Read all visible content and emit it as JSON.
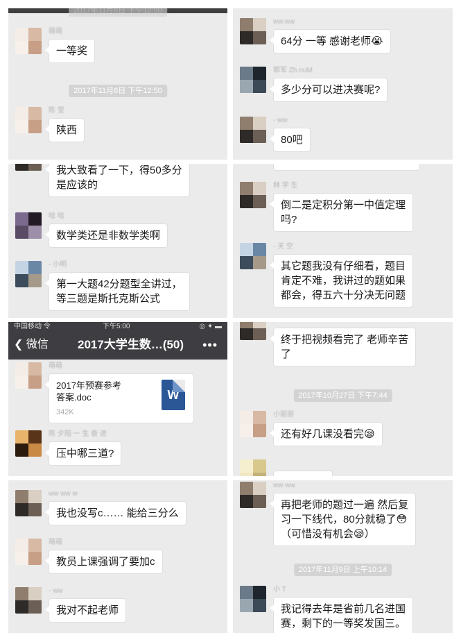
{
  "panel1": {
    "top_timestamp": "2017年11月8日 下午12:50",
    "msg1": {
      "name": "萌萌",
      "text": "一等奖"
    },
    "timestamp": "2017年11月8日 下午12:50",
    "msg2": {
      "name": "陈 莹",
      "text": "陕西"
    }
  },
  "panel2": {
    "msg1": {
      "name": "ww.ww",
      "text": "64分 一等 感谢老师😭"
    },
    "msg2": {
      "name": "郭军 Zh.nuM",
      "text": "多少分可以进决赛呢?"
    },
    "msg3": {
      "name": "- ww",
      "text": "80吧"
    }
  },
  "panel3": {
    "msg1": {
      "text": "我大致看了一下，得50多分\n是应该的"
    },
    "msg2": {
      "name": "哈 哈",
      "text": "数学类还是非数学类啊"
    },
    "msg3": {
      "name": "- 小明",
      "text": "第一大题42分题型全讲过，\n等三题是斯托克斯公式"
    }
  },
  "panel4": {
    "msg1": {
      "name": "林 学 生",
      "text": "倒二是定积分第一中值定理\n吗?"
    },
    "msg2": {
      "name": "- 天 空",
      "text": "其它题我没有仔细看，题目\n肯定不难，我讲过的题如果\n都会，得五六十分决无问题"
    }
  },
  "panel5": {
    "status": {
      "carrier": "中国移动 令",
      "time": "下午5:00",
      "icons": "◎ ✦ ▬"
    },
    "nav": {
      "back_label": "微信",
      "title": "2017大学生数…(50)",
      "more": "•••"
    },
    "msg1": {
      "name": "萌萌",
      "file_name": "2017年预赛参考\n答案.doc",
      "file_size": "342K",
      "file_icon": "W"
    },
    "msg2": {
      "name": "陈 夕阳 一 生 奋 进",
      "text": "压中哪三道?"
    }
  },
  "panel6": {
    "msg1": {
      "text": "终于把视频看完了 老师辛苦\n了"
    },
    "timestamp": "2017年10月27日 下午7:44",
    "msg2": {
      "name": "小丽丽",
      "text": "还有好几课没看完😪"
    }
  },
  "panel7": {
    "msg1": {
      "name": "ww ww w",
      "text": "我也没写c…… 能给三分么"
    },
    "msg2": {
      "name": "萌萌",
      "text": "教员上课强调了要加c"
    },
    "msg3": {
      "name": "- ww",
      "text": "我对不起老师"
    }
  },
  "panel8": {
    "msg1": {
      "name": "ww ww",
      "text": "再把老师的题过一遍 然后复\n习一下线代，80分就稳了😳\n（可惜没有机会😪）"
    },
    "timestamp": "2017年11月9日 上午10:14",
    "msg2": {
      "name": "小 T",
      "text": "我记得去年是省前几名进国\n赛，剩下的一等奖发国三。"
    }
  }
}
